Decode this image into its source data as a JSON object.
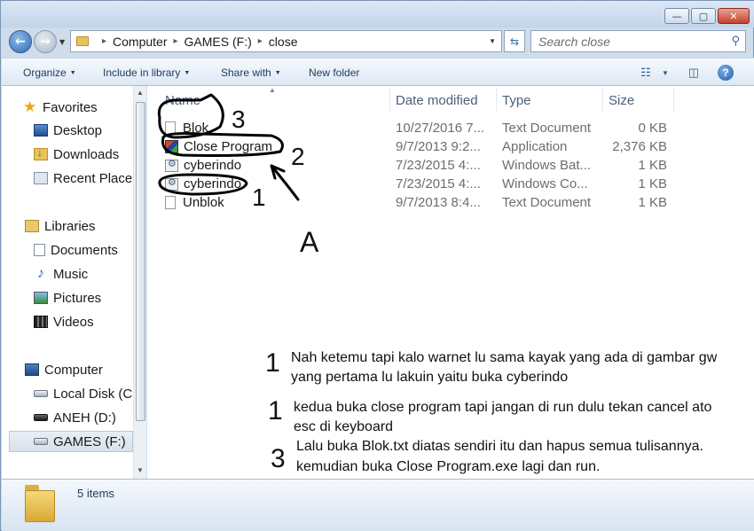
{
  "window": {
    "minimize_label": "—",
    "maximize_label": "▢",
    "close_label": "✕"
  },
  "address": {
    "path": [
      "Computer",
      "GAMES (F:)",
      "close"
    ],
    "back_label": "←",
    "forward_label": "→"
  },
  "search": {
    "placeholder": "Search close"
  },
  "toolbar": {
    "organize": "Organize",
    "include_in_library": "Include in library",
    "share_with": "Share with",
    "new_folder": "New folder"
  },
  "nav": {
    "favorites": {
      "header": "Favorites",
      "items": [
        "Desktop",
        "Downloads",
        "Recent Places"
      ]
    },
    "libraries": {
      "header": "Libraries",
      "items": [
        "Documents",
        "Music",
        "Pictures",
        "Videos"
      ]
    },
    "computer": {
      "header": "Computer",
      "items": [
        "Local Disk (C:)",
        "ANEH (D:)",
        "GAMES (F:)"
      ]
    },
    "selected": "GAMES (F:)"
  },
  "columns": {
    "name": "Name",
    "date_modified": "Date modified",
    "type": "Type",
    "size": "Size"
  },
  "files": [
    {
      "name": "Blok",
      "date": "10/27/2016 7...",
      "type": "Text Document",
      "size": "0 KB",
      "icon": "text-file-icon"
    },
    {
      "name": "Close Program",
      "date": "9/7/2013 9:2...",
      "type": "Application",
      "size": "2,376 KB",
      "icon": "application-icon"
    },
    {
      "name": "cyberindo",
      "date": "7/23/2015 4:...",
      "type": "Windows Bat...",
      "size": "1 KB",
      "icon": "batch-file-icon"
    },
    {
      "name": "cyberindo",
      "date": "7/23/2015 4:...",
      "type": "Windows Co...",
      "size": "1 KB",
      "icon": "batch-file-icon"
    },
    {
      "name": "Unblok",
      "date": "9/7/2013 8:4...",
      "type": "Text Document",
      "size": "1 KB",
      "icon": "text-file-icon"
    }
  ],
  "annotations": {
    "marks": [
      "3",
      "2",
      "1",
      "A"
    ],
    "notes": [
      {
        "number": "1",
        "lines": [
          "Nah ketemu tapi kalo warnet lu sama kayak yang ada di gambar gw",
          "yang pertama lu lakuin yaitu buka cyberindo"
        ]
      },
      {
        "number": "1",
        "lines": [
          "kedua buka close program tapi jangan di run dulu tekan cancel ato",
          "esc di keyboard"
        ]
      },
      {
        "number": "3",
        "lines": [
          "Lalu buka Blok.txt diatas sendiri itu dan hapus semua tulisannya.",
          "kemudian buka Close Program.exe lagi dan run."
        ]
      }
    ]
  },
  "status": {
    "item_count": "5 items"
  },
  "colors": {
    "accent": "#1e395b",
    "annotation_ink": "#000000"
  }
}
